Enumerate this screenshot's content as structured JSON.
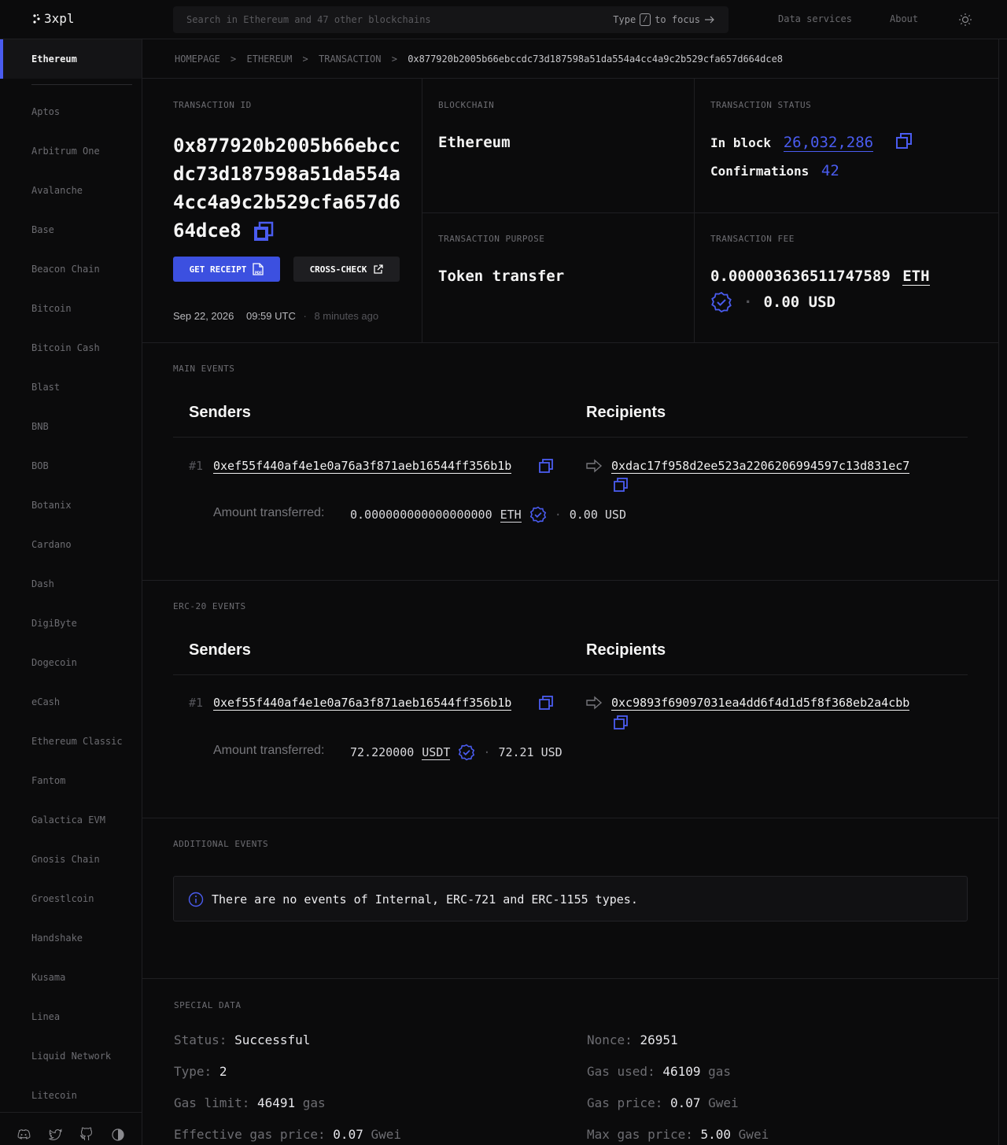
{
  "header": {
    "logo": "3xpl",
    "search_placeholder": "Search in Ethereum and 47 other blockchains",
    "search_hint_pre": "Type",
    "search_hint_key": "/",
    "search_hint_post": "to focus",
    "nav": [
      "Data services",
      "About"
    ]
  },
  "sidebar": {
    "active": "Ethereum",
    "items": [
      "Aptos",
      "Arbitrum One",
      "Avalanche",
      "Base",
      "Beacon Chain",
      "Bitcoin",
      "Bitcoin Cash",
      "Blast",
      "BNB",
      "BOB",
      "Botanix",
      "Cardano",
      "Dash",
      "DigiByte",
      "Dogecoin",
      "eCash",
      "Ethereum Classic",
      "Fantom",
      "Galactica EVM",
      "Gnosis Chain",
      "Groestlcoin",
      "Handshake",
      "Kusama",
      "Linea",
      "Liquid Network",
      "Litecoin"
    ],
    "footer_icons": [
      "discord-icon",
      "twitter-icon",
      "github-icon",
      "theme-icon"
    ]
  },
  "breadcrumb": {
    "items": [
      "HOMEPAGE",
      "ETHEREUM",
      "TRANSACTION"
    ],
    "separator": ">",
    "current": "0x877920b2005b66ebccdc73d187598a51da554a4cc4a9c2b529cfa657d664dce8"
  },
  "tx": {
    "id_label": "TRANSACTION ID",
    "id": "0x877920b2005b66ebccdc73d187598a51da554a4cc4a9c2b529cfa657d664dce8",
    "receipt_btn": "GET RECEIPT",
    "crosscheck_btn": "CROSS-CHECK",
    "date": "Sep 22, 2026",
    "time": "09:59 UTC",
    "ago": "8 minutes ago",
    "blockchain_label": "BLOCKCHAIN",
    "blockchain": "Ethereum",
    "status_label": "TRANSACTION STATUS",
    "in_block_label": "In block",
    "block": "26,032,286",
    "confirmations_label": "Confirmations",
    "confirmations": "42",
    "purpose_label": "TRANSACTION PURPOSE",
    "purpose": "Token transfer",
    "fee_label": "TRANSACTION FEE",
    "fee": "0.000003636511747589",
    "fee_unit": "ETH",
    "fee_usd": "0.00 USD"
  },
  "main_events": {
    "label": "MAIN EVENTS",
    "senders": "Senders",
    "recipients": "Recipients",
    "index": "#1",
    "sender": "0xef55f440af4e1e0a76a3f871aeb16544ff356b1b",
    "recipient": "0xdac17f958d2ee523a2206206994597c13d831ec7",
    "amount_label": "Amount transferred:",
    "amount": "0.000000000000000000",
    "token": "ETH",
    "usd": "0.00 USD"
  },
  "erc20_events": {
    "label": "ERC-20 EVENTS",
    "senders": "Senders",
    "recipients": "Recipients",
    "index": "#1",
    "sender": "0xef55f440af4e1e0a76a3f871aeb16544ff356b1b",
    "recipient": "0xc9893f69097031ea4dd6f4d1d5f8f368eb2a4cbb",
    "amount_label": "Amount transferred:",
    "amount": "72.220000",
    "token": "USDT",
    "usd": "72.21 USD"
  },
  "additional_events": {
    "label": "ADDITIONAL EVENTS",
    "notice": "There are no events of Internal, ERC-721 and ERC-1155 types."
  },
  "special_data": {
    "label": "SPECIAL DATA",
    "status_k": "Status:",
    "status_v": "Successful",
    "type_k": "Type:",
    "type_v": "2",
    "gas_limit_k": "Gas limit:",
    "gas_limit_v": "46491",
    "gas_limit_u": "gas",
    "eff_gas_k": "Effective gas price:",
    "eff_gas_v": "0.07",
    "eff_gas_u": "Gwei",
    "nonce_k": "Nonce:",
    "nonce_v": "26951",
    "gas_used_k": "Gas used:",
    "gas_used_v": "46109",
    "gas_used_u": "gas",
    "gas_price_k": "Gas price:",
    "gas_price_v": "0.07",
    "gas_price_u": "Gwei",
    "max_gas_k": "Max gas price:",
    "max_gas_v": "5.00",
    "max_gas_u": "Gwei"
  },
  "colors": {
    "accent": "#4a5cf0",
    "background": "#0b0b0c"
  }
}
